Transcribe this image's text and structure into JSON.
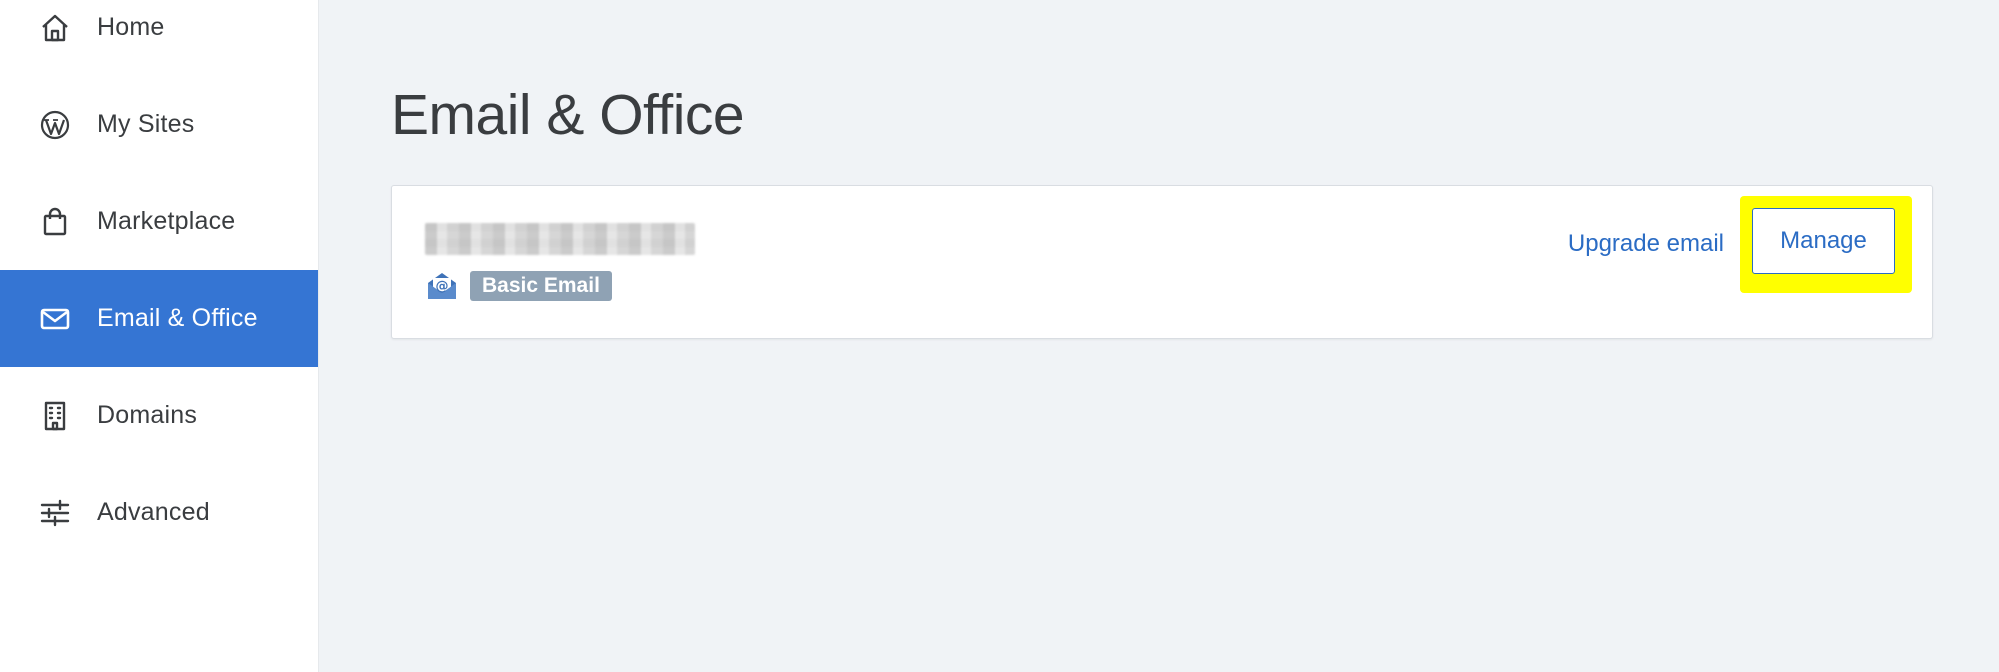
{
  "sidebar": {
    "items": [
      {
        "label": "Home",
        "icon": "home-icon",
        "active": false
      },
      {
        "label": "My Sites",
        "icon": "wordpress-icon",
        "active": false
      },
      {
        "label": "Marketplace",
        "icon": "shopping-bag-icon",
        "active": false
      },
      {
        "label": "Email & Office",
        "icon": "envelope-icon",
        "active": true
      },
      {
        "label": "Domains",
        "icon": "building-icon",
        "active": false
      },
      {
        "label": "Advanced",
        "icon": "sliders-icon",
        "active": false
      }
    ]
  },
  "main": {
    "title": "Email & Office",
    "email_card": {
      "address_blurred": true,
      "product_icon": "email-product-icon",
      "badge": "Basic Email",
      "upgrade_label": "Upgrade email",
      "manage_label": "Manage",
      "manage_highlighted": true
    }
  },
  "colors": {
    "accent": "#3575d3",
    "link": "#2b6cc4",
    "badge": "#8fa2b4",
    "highlight": "#ffff00",
    "background": "#f0f3f6"
  }
}
